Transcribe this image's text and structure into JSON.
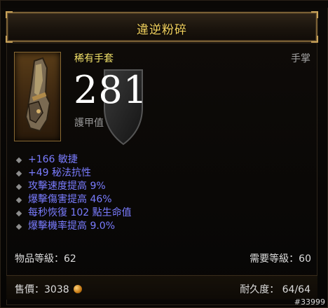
{
  "item": {
    "name": "違逆粉碎",
    "rarity_type": "稀有手套",
    "slot": "手掌",
    "armor_value": "281",
    "armor_label": "護甲值",
    "name_color": "#f4d35e"
  },
  "properties": [
    "+166 敏捷",
    "+49 秘法抗性",
    "攻擊速度提高 9%",
    "爆擊傷害提高 46%",
    "每秒恢復 102 點生命值",
    "爆擊機率提高 9.0%"
  ],
  "levels": {
    "item_level": "物品等級：62",
    "required_level": "需要等級：60"
  },
  "footer": {
    "sell_value": "售價：3038",
    "durability": "耐久度：  64/64"
  },
  "watermark": "#33999",
  "icons": {
    "item_icon": "gloves-icon",
    "armor_icon": "shield-icon",
    "currency_icon": "gold-coin-icon"
  }
}
